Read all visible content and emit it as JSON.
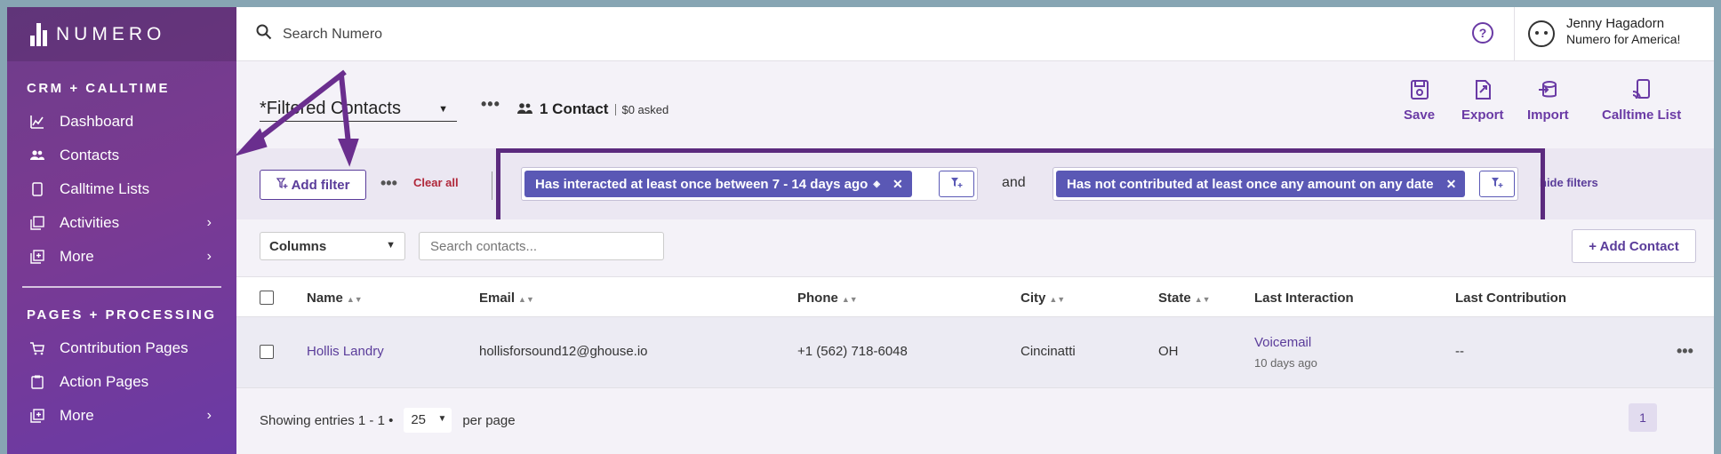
{
  "brand": {
    "name": "NUMERO"
  },
  "sidebar": {
    "sections": [
      {
        "heading": "CRM + CALLTIME",
        "items": [
          {
            "label": "Dashboard",
            "icon": "chart-icon"
          },
          {
            "label": "Contacts",
            "icon": "people-icon"
          },
          {
            "label": "Calltime Lists",
            "icon": "phone-icon"
          },
          {
            "label": "Activities",
            "icon": "activities-icon"
          },
          {
            "label": "More",
            "icon": "more-icon"
          }
        ]
      },
      {
        "heading": "PAGES + PROCESSING",
        "items": [
          {
            "label": "Contribution Pages",
            "icon": "cart-icon"
          },
          {
            "label": "Action Pages",
            "icon": "clipboard-icon"
          },
          {
            "label": "More",
            "icon": "more-icon"
          }
        ]
      }
    ]
  },
  "topbar": {
    "search_placeholder": "Search Numero",
    "user_name": "Jenny Hagadorn",
    "user_org": "Numero for America!"
  },
  "header": {
    "view_name": "*Filtered Contacts",
    "contact_count": "1 Contact",
    "asked": "$0 asked",
    "actions": [
      {
        "label": "Save",
        "icon": "save-icon"
      },
      {
        "label": "Export",
        "icon": "export-icon"
      },
      {
        "label": "Import",
        "icon": "import-icon"
      },
      {
        "label": "Calltime List",
        "icon": "calltime-list-icon"
      }
    ]
  },
  "filters": {
    "add_filter_label": "Add filter",
    "clear_all_label": "Clear all",
    "conjunction": "and",
    "hide_filters_label": "hide filters",
    "chips": [
      {
        "label": "Has interacted at least once between 7 - 14 days ago"
      },
      {
        "label": "Has not contributed at least once any amount on any date"
      }
    ]
  },
  "toolbar": {
    "columns_label": "Columns",
    "search_placeholder": "Search contacts...",
    "add_contact_label": "+ Add Contact"
  },
  "table": {
    "columns": [
      "Name",
      "Email",
      "Phone",
      "City",
      "State",
      "Last Interaction",
      "Last Contribution"
    ],
    "rows": [
      {
        "name": "Hollis Landry",
        "email": "hollisforsound12@ghouse.io",
        "phone": "+1 (562) 718-6048",
        "city": "Cincinatti",
        "state": "OH",
        "last_interaction": "Voicemail",
        "last_interaction_when": "10 days ago",
        "last_contribution": "--"
      }
    ]
  },
  "footer": {
    "showing": "Showing entries 1 - 1 •",
    "per_page_value": "25",
    "per_page_label": "per page",
    "current_page": "1"
  },
  "colors": {
    "accent": "#5a3c9a",
    "chip": "#5a58b5",
    "annotation": "#6a2e8e",
    "danger": "#b0273a"
  }
}
